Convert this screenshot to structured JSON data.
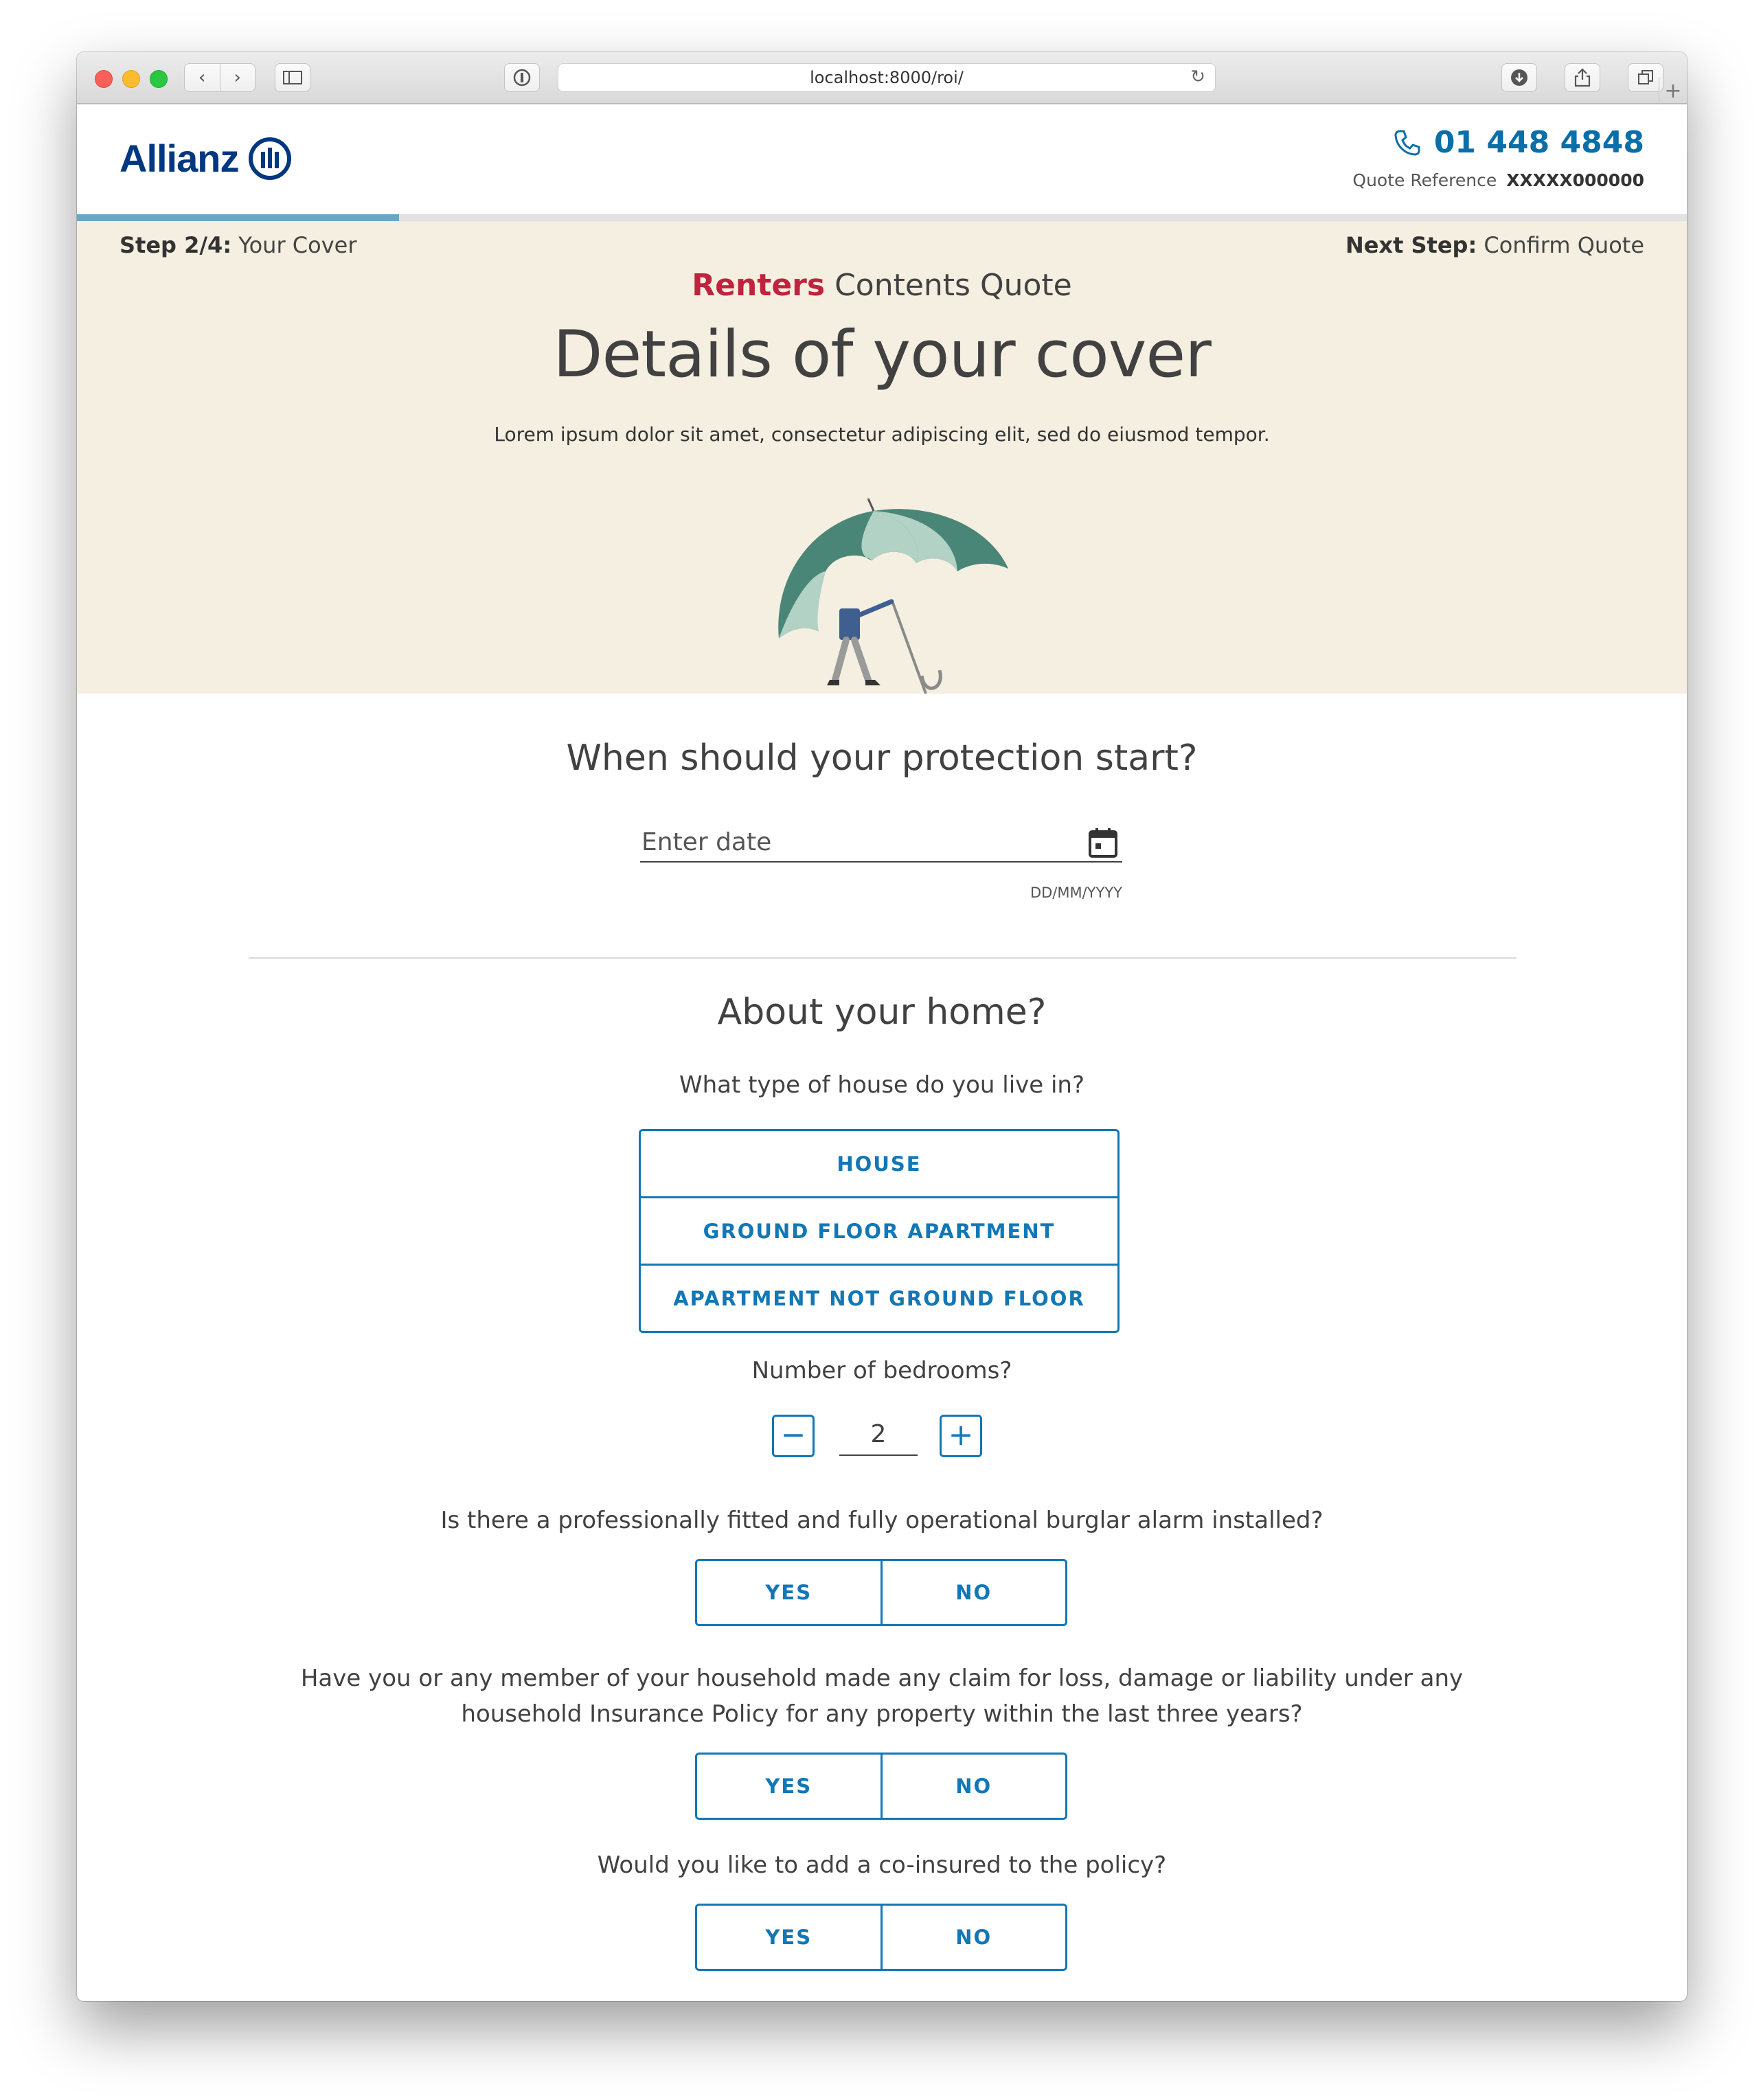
{
  "browser": {
    "url": "localhost:8000/roi/"
  },
  "header": {
    "brand": "Allianz",
    "phone": "01 448 4848",
    "quote_ref_label": "Quote Reference",
    "quote_ref_value": "XXXXX000000"
  },
  "progress": {
    "current_step": 2,
    "total_steps": 4,
    "fill_fraction": 0.2
  },
  "steps": {
    "current_label": "Step 2/4:",
    "current_name": "Your Cover",
    "next_label": "Next Step:",
    "next_name": "Confirm Quote"
  },
  "hero": {
    "product_accent": "Renters",
    "product_rest": "Contents Quote",
    "title": "Details of your cover",
    "subtitle": "Lorem ipsum dolor sit amet, consectetur adipiscing elit, sed do eiusmod tempor."
  },
  "start_date": {
    "heading": "When should your protection start?",
    "placeholder": "Enter date",
    "format_hint": "DD/MM/YYYY"
  },
  "home": {
    "heading": "About your home?",
    "house_type_question": "What type of house do you live in?",
    "house_types": [
      "HOUSE",
      "GROUND FLOOR APARTMENT",
      "APARTMENT NOT GROUND FLOOR"
    ],
    "bedrooms_question": "Number of bedrooms?",
    "bedrooms_value": "2",
    "decrement_symbol": "−",
    "increment_symbol": "+",
    "alarm_question": "Is there a professionally fitted and fully operational burglar alarm installed?",
    "claims_question_line1": "Have you or any member of your household made any claim for loss, damage or liability under any",
    "claims_question_line2": "household Insurance Policy for any property within the last three years?",
    "coinsured_question": "Would you like to add a co-insured to the policy?",
    "yes_label": "YES",
    "no_label": "NO"
  },
  "colors": {
    "brand_blue": "#003781",
    "action_blue": "#1277b6",
    "accent_red": "#c0233d",
    "hero_bg": "#f4efe0",
    "progress": "#6aa6c6"
  },
  "icons": {
    "phone": "phone-icon",
    "calendar": "calendar-icon",
    "logo": "allianz-eagle-icon",
    "illustration": "umbrella-person-illustration"
  }
}
